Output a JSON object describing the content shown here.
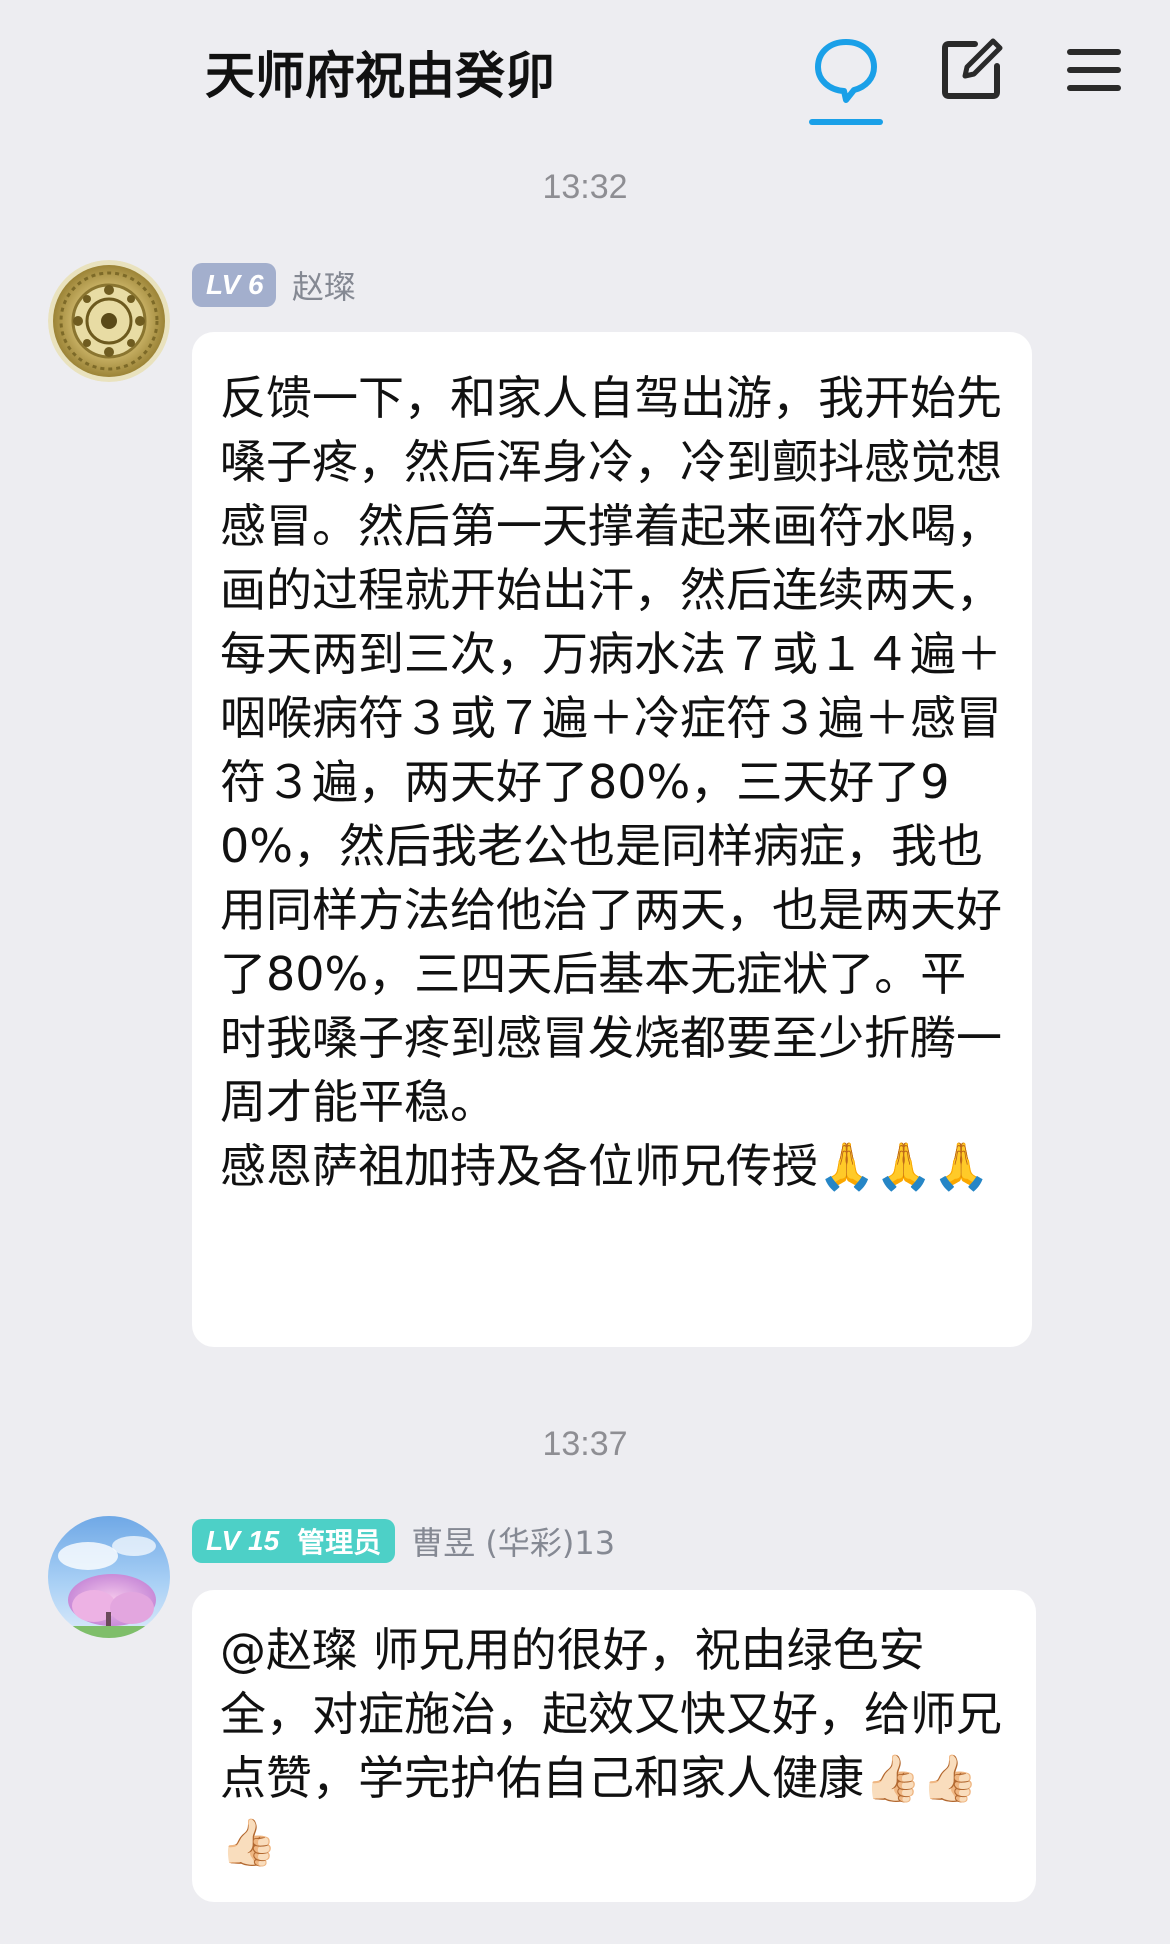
{
  "header": {
    "title": "天师府祝由癸卯",
    "icons": [
      "chat-bubble-icon",
      "edit-icon",
      "menu-icon"
    ],
    "accent_color": "#1AA0E8"
  },
  "messages": [
    {
      "time": "13:32",
      "level_badge": "LV 6",
      "sender": "赵璨",
      "text": "反馈一下，和家人自驾出游，我开始先嗓子疼，然后浑身冷，冷到颤抖感觉想感冒。然后第一天撑着起来画符水喝，画的过程就开始出汗，然后连续两天，每天两到三次，万病水法７或１４遍＋咽喉病符３或７遍＋冷症符３遍＋感冒符３遍，两天好了80%，三天好了90%，然后我老公也是同样病症，我也用同样方法给他治了两天，也是两天好了80%，三四天后基本无症状了。平时我嗓子疼到感冒发烧都要至少折腾一周才能平稳。\n感恩萨祖加持及各位师兄传授🙏🙏🙏",
      "avatar": "golden-mandala-avatar"
    },
    {
      "time": "13:37",
      "level_badge": "LV 15",
      "role_badge": "管理员",
      "sender": "曹昱 (华彩)13",
      "text": "@赵璨 师兄用的很好，祝由绿色安全，对症施治，起效又快又好，给师兄点赞，学完护佑自己和家人健康👍🏻👍🏻👍🏻",
      "avatar": "pink-blossom-sky-avatar"
    }
  ]
}
